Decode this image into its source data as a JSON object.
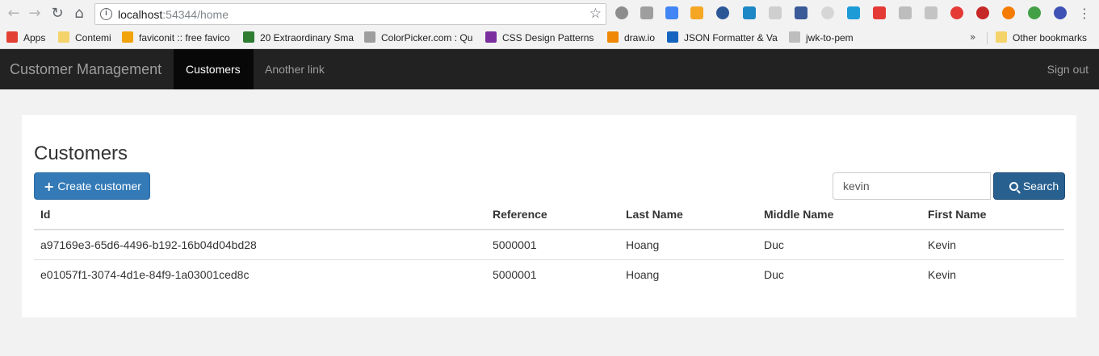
{
  "browser": {
    "url_host": "localhost",
    "url_port_path": ":54344/home",
    "bookmarks": [
      {
        "label": "Apps",
        "color": "#e34133"
      },
      {
        "label": "Contemi",
        "color": "#f5d36b"
      },
      {
        "label": "faviconit :: free favico",
        "color": "#f0a30a"
      },
      {
        "label": "20 Extraordinary Sma",
        "color": "#2e7d32"
      },
      {
        "label": "ColorPicker.com : Qu",
        "color": "#9e9e9e"
      },
      {
        "label": "CSS Design Patterns",
        "color": "#7b2f9e"
      },
      {
        "label": "draw.io",
        "color": "#f08705"
      },
      {
        "label": "JSON Formatter & Va",
        "color": "#1565c0"
      },
      {
        "label": "jwk-to-pem",
        "color": "#bdbdbd"
      }
    ],
    "other_bookmarks": "Other bookmarks",
    "overflow": "»"
  },
  "navbar": {
    "brand": "Customer Management",
    "active_link": "Customers",
    "link": "Another link",
    "signout": "Sign out"
  },
  "page": {
    "title": "Customers",
    "create_button": "Create customer",
    "search_value": "kevin",
    "search_button": "Search"
  },
  "table": {
    "headers": [
      "Id",
      "Reference",
      "Last Name",
      "Middle Name",
      "First Name"
    ],
    "rows": [
      [
        "a97169e3-65d6-4496-b192-16b04d04bd28",
        "5000001",
        "Hoang",
        "Duc",
        "Kevin"
      ],
      [
        "e01057f1-3074-4d1e-84f9-1a03001ced8c",
        "5000001",
        "Hoang",
        "Duc",
        "Kevin"
      ]
    ]
  },
  "colors": {
    "primary": "#337ab7",
    "primary_dark": "#286090",
    "navbar": "#222222"
  }
}
